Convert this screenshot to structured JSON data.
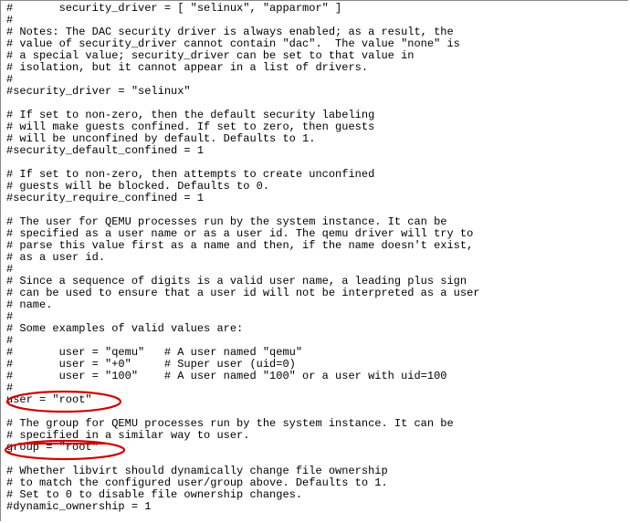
{
  "lines": [
    "#       security_driver = [ \"selinux\", \"apparmor\" ]",
    "#",
    "# Notes: The DAC security driver is always enabled; as a result, the",
    "# value of security_driver cannot contain \"dac\".  The value \"none\" is",
    "# a special value; security_driver can be set to that value in",
    "# isolation, but it cannot appear in a list of drivers.",
    "#",
    "#security_driver = \"selinux\"",
    "",
    "# If set to non-zero, then the default security labeling",
    "# will make guests confined. If set to zero, then guests",
    "# will be unconfined by default. Defaults to 1.",
    "#security_default_confined = 1",
    "",
    "# If set to non-zero, then attempts to create unconfined",
    "# guests will be blocked. Defaults to 0.",
    "#security_require_confined = 1",
    "",
    "# The user for QEMU processes run by the system instance. It can be",
    "# specified as a user name or as a user id. The qemu driver will try to",
    "# parse this value first as a name and then, if the name doesn't exist,",
    "# as a user id.",
    "#",
    "# Since a sequence of digits is a valid user name, a leading plus sign",
    "# can be used to ensure that a user id will not be interpreted as a user",
    "# name.",
    "#",
    "# Some examples of valid values are:",
    "#",
    "#       user = \"qemu\"   # A user named \"qemu\"",
    "#       user = \"+0\"     # Super user (uid=0)",
    "#       user = \"100\"    # A user named \"100\" or a user with uid=100",
    "#",
    "user = \"root\"",
    "",
    "# The group for QEMU processes run by the system instance. It can be",
    "# specified in a similar way to user.",
    "group = \"root\"",
    "",
    "# Whether libvirt should dynamically change file ownership",
    "# to match the configured user/group above. Defaults to 1.",
    "# Set to 0 to disable file ownership changes.",
    "#dynamic_ownership = 1",
    ""
  ],
  "annotations": {
    "ellipse1_label": "user-root-highlight",
    "ellipse2_label": "group-root-highlight",
    "strike_label": "specified-in-strike"
  }
}
